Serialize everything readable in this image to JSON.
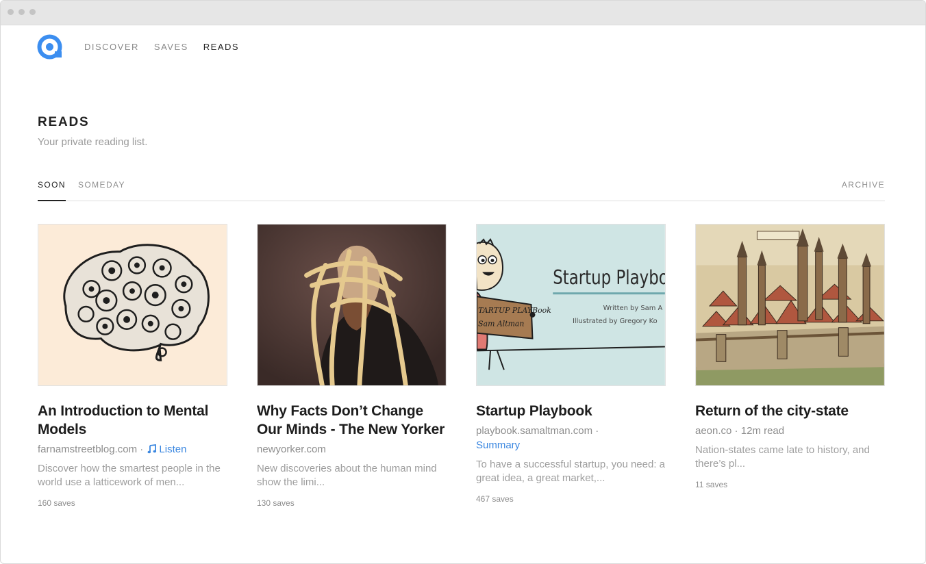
{
  "nav": {
    "logo_icon": "at-sign-logo-icon",
    "items": [
      {
        "label": "DISCOVER"
      },
      {
        "label": "SAVES"
      },
      {
        "label": "READS"
      }
    ],
    "active": "READS"
  },
  "header": {
    "title": "READS",
    "subtitle": "Your private reading list."
  },
  "tabs": {
    "soon": "SOON",
    "someday": "SOMEDAY",
    "archive": "ARCHIVE",
    "active": "SOON"
  },
  "cards": [
    {
      "title": "An Introduction to Mental Models",
      "source": "farnamstreetblog.com",
      "sep": " · ",
      "action": "Listen",
      "action_icon": "music-note-icon",
      "excerpt": "Discover how the smartest people in the world use a latticework of men...",
      "saves": "160 saves",
      "image": "gear-brain-illustration"
    },
    {
      "title": "Why Facts Don’t Change Our Minds - The New Yorker",
      "source": "newyorker.com",
      "excerpt": "New discoveries about the human mind show the limi...",
      "saves": "130 saves",
      "image": "bound-man-painting"
    },
    {
      "title": "Startup Playbook",
      "source": "playbook.samaltman.com",
      "sep": " ·",
      "action": "Summary",
      "excerpt": "To have a successful startup, you need: a great idea, a great market,...",
      "saves": "467 saves",
      "image": "startup-playbook-cover",
      "cover": {
        "heading": "Startup Playbo",
        "written_by": "Written by Sam A",
        "illustrated_by": "Illustrated by Gregory Ko",
        "sign_line1": "TARTUP PLAYBook",
        "sign_line2": "Sam Altman"
      }
    },
    {
      "title": "Return of the city-state",
      "source": "aeon.co",
      "sep": " · ",
      "read_time": "12m read",
      "excerpt": "Nation-states came late to history, and there’s pl...",
      "saves": "11 saves",
      "image": "medieval-city-woodcut"
    }
  ],
  "colors": {
    "accent": "#3b87e0",
    "logo": "#3c8ef0",
    "text": "#1d1d1d",
    "muted": "#8d8d8d"
  }
}
